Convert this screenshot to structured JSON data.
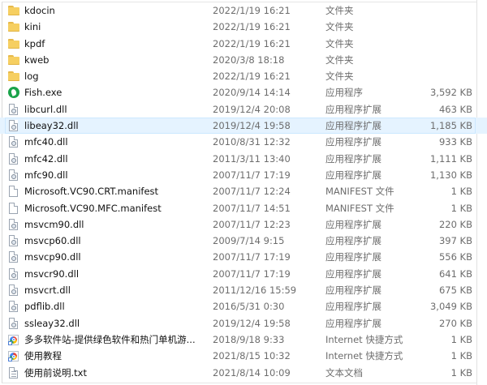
{
  "files": [
    {
      "name": "kdocin",
      "date": "2022/1/19 16:21",
      "type": "文件夹",
      "size": "",
      "icon": "folder-icon"
    },
    {
      "name": "kini",
      "date": "2022/1/19 16:21",
      "type": "文件夹",
      "size": "",
      "icon": "folder-icon"
    },
    {
      "name": "kpdf",
      "date": "2022/1/19 16:21",
      "type": "文件夹",
      "size": "",
      "icon": "folder-icon"
    },
    {
      "name": "kweb",
      "date": "2020/3/8 18:18",
      "type": "文件夹",
      "size": "",
      "icon": "folder-icon"
    },
    {
      "name": "log",
      "date": "2022/1/19 16:21",
      "type": "文件夹",
      "size": "",
      "icon": "folder-icon"
    },
    {
      "name": "Fish.exe",
      "date": "2020/9/14 14:14",
      "type": "应用程序",
      "size": "3,592 KB",
      "icon": "exe-app-icon"
    },
    {
      "name": "libcurl.dll",
      "date": "2019/12/4 20:08",
      "type": "应用程序扩展",
      "size": "463 KB",
      "icon": "dll-icon"
    },
    {
      "name": "libeay32.dll",
      "date": "2019/12/4 19:58",
      "type": "应用程序扩展",
      "size": "1,185 KB",
      "icon": "dll-icon"
    },
    {
      "name": "mfc40.dll",
      "date": "2010/8/31 12:32",
      "type": "应用程序扩展",
      "size": "933 KB",
      "icon": "dll-icon"
    },
    {
      "name": "mfc42.dll",
      "date": "2011/3/11 13:40",
      "type": "应用程序扩展",
      "size": "1,111 KB",
      "icon": "dll-icon"
    },
    {
      "name": "mfc90.dll",
      "date": "2007/11/7 17:19",
      "type": "应用程序扩展",
      "size": "1,130 KB",
      "icon": "dll-icon"
    },
    {
      "name": "Microsoft.VC90.CRT.manifest",
      "date": "2007/11/7 12:24",
      "type": "MANIFEST 文件",
      "size": "1 KB",
      "icon": "file-icon"
    },
    {
      "name": "Microsoft.VC90.MFC.manifest",
      "date": "2007/11/7 14:51",
      "type": "MANIFEST 文件",
      "size": "1 KB",
      "icon": "file-icon"
    },
    {
      "name": "msvcm90.dll",
      "date": "2007/11/7 12:23",
      "type": "应用程序扩展",
      "size": "220 KB",
      "icon": "dll-icon"
    },
    {
      "name": "msvcp60.dll",
      "date": "2009/7/14 9:15",
      "type": "应用程序扩展",
      "size": "397 KB",
      "icon": "dll-icon"
    },
    {
      "name": "msvcp90.dll",
      "date": "2007/11/7 17:19",
      "type": "应用程序扩展",
      "size": "556 KB",
      "icon": "dll-icon"
    },
    {
      "name": "msvcr90.dll",
      "date": "2007/11/7 17:19",
      "type": "应用程序扩展",
      "size": "641 KB",
      "icon": "dll-icon"
    },
    {
      "name": "msvcrt.dll",
      "date": "2011/12/16 15:59",
      "type": "应用程序扩展",
      "size": "675 KB",
      "icon": "dll-icon"
    },
    {
      "name": "pdflib.dll",
      "date": "2016/5/31 0:30",
      "type": "应用程序扩展",
      "size": "3,049 KB",
      "icon": "dll-icon"
    },
    {
      "name": "ssleay32.dll",
      "date": "2019/12/4 19:58",
      "type": "应用程序扩展",
      "size": "270 KB",
      "icon": "dll-icon"
    },
    {
      "name": "多多软件站-提供绿色软件和热门单机游...",
      "date": "2018/9/18 9:33",
      "type": "Internet 快捷方式",
      "size": "1 KB",
      "icon": "internet-shortcut-icon"
    },
    {
      "name": "使用教程",
      "date": "2021/8/15 10:32",
      "type": "Internet 快捷方式",
      "size": "1 KB",
      "icon": "internet-shortcut-icon"
    },
    {
      "name": "使用前说明.txt",
      "date": "2021/8/14 10:09",
      "type": "文本文档",
      "size": "1 KB",
      "icon": "text-file-icon"
    }
  ],
  "selected_index": 7
}
